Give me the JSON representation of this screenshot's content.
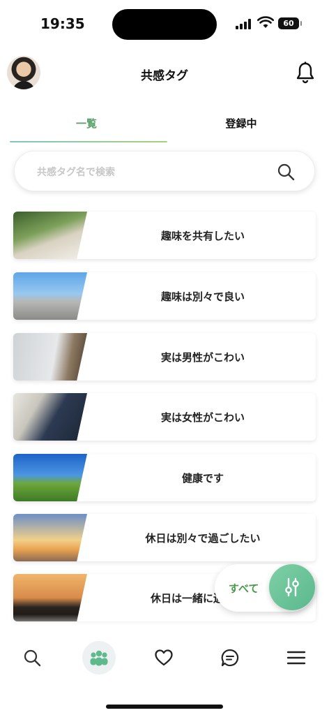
{
  "status": {
    "time": "19:35",
    "battery": "60"
  },
  "header": {
    "title": "共感タグ",
    "avatar": "avatar",
    "bell_icon": "bell-icon"
  },
  "tabs": [
    {
      "label": "一覧",
      "active": true
    },
    {
      "label": "登録中",
      "active": false
    }
  ],
  "search": {
    "placeholder": "共感タグ名で検索",
    "icon": "search-icon"
  },
  "tags": [
    {
      "label": "趣味を共有したい"
    },
    {
      "label": "趣味は別々で良い"
    },
    {
      "label": "実は男性がこわい"
    },
    {
      "label": "実は女性がこわい"
    },
    {
      "label": "健康です"
    },
    {
      "label": "休日は別々で過ごしたい"
    },
    {
      "label": "休日は一緒に過ごした"
    }
  ],
  "filter": {
    "label": "すべて",
    "icon": "filter-sliders-icon"
  },
  "bottom_nav": [
    {
      "name": "search",
      "icon": "search-icon",
      "active": false
    },
    {
      "name": "community",
      "icon": "group-icon",
      "active": true
    },
    {
      "name": "favorites",
      "icon": "heart-icon",
      "active": false
    },
    {
      "name": "messages",
      "icon": "chat-icon",
      "active": false
    },
    {
      "name": "menu",
      "icon": "menu-icon",
      "active": false
    }
  ],
  "colors": {
    "accent": "#5aa06a",
    "fab": "#6cc499"
  }
}
